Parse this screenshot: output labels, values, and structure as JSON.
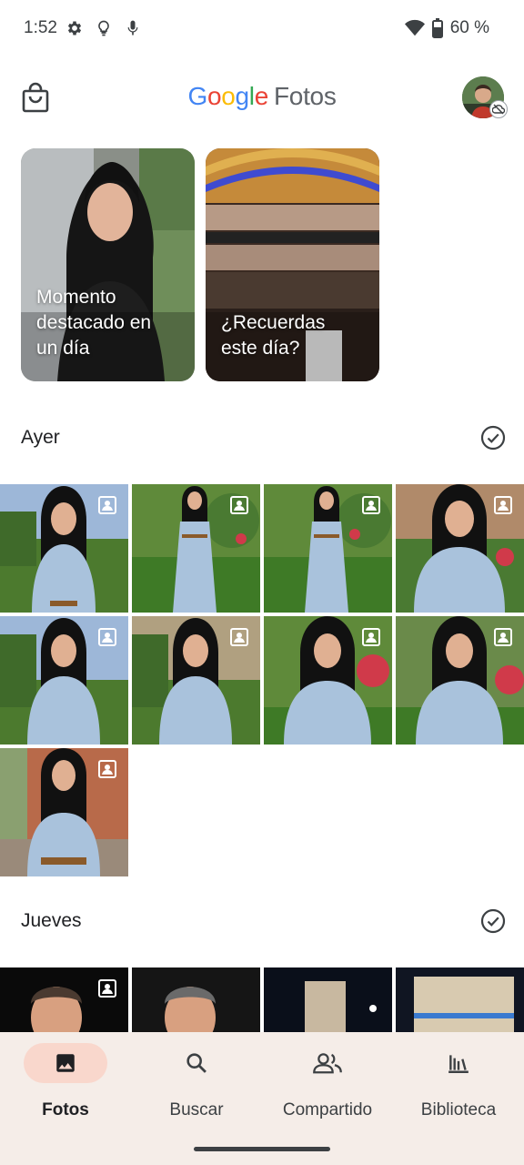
{
  "status_bar": {
    "time": "1:52",
    "battery": "60 %",
    "icons": [
      "settings-icon",
      "lightbulb-icon",
      "mic-icon",
      "wifi-icon",
      "battery-icon"
    ]
  },
  "app_bar": {
    "logo_google": [
      "G",
      "o",
      "o",
      "g",
      "l",
      "e"
    ],
    "logo_google_colors": [
      "#4285F4",
      "#EA4335",
      "#FBBC05",
      "#4285F4",
      "#34A853",
      "#EA4335"
    ],
    "logo_product": "Fotos"
  },
  "memories": [
    {
      "title": "Momento\ndestacado en\nun día"
    },
    {
      "title": "¿Recuerdas\neste día?"
    }
  ],
  "sections": [
    {
      "title": "Ayer",
      "photo_count": 9
    },
    {
      "title": "Jueves",
      "photo_count": 4
    }
  ],
  "bottom_nav": {
    "items": [
      {
        "label": "Fotos",
        "icon": "photo-icon",
        "active": true
      },
      {
        "label": "Buscar",
        "icon": "search-icon",
        "active": false
      },
      {
        "label": "Compartido",
        "icon": "people-icon",
        "active": false
      },
      {
        "label": "Biblioteca",
        "icon": "library-icon",
        "active": false
      }
    ]
  },
  "colors": {
    "accent_nav_pill": "#f9d7cc",
    "nav_background": "#f5ede8"
  }
}
